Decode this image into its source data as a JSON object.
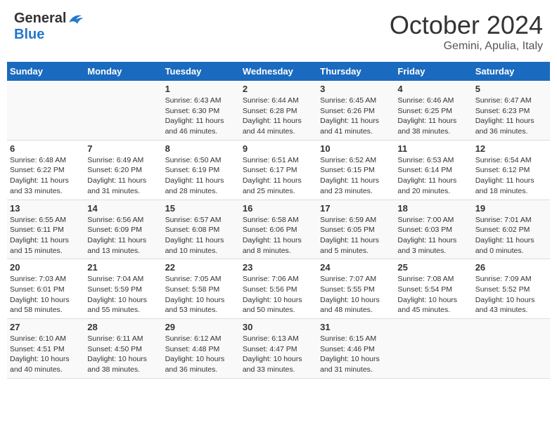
{
  "header": {
    "logo_general": "General",
    "logo_blue": "Blue",
    "month": "October 2024",
    "location": "Gemini, Apulia, Italy"
  },
  "columns": [
    "Sunday",
    "Monday",
    "Tuesday",
    "Wednesday",
    "Thursday",
    "Friday",
    "Saturday"
  ],
  "weeks": [
    [
      {
        "day": "",
        "content": ""
      },
      {
        "day": "",
        "content": ""
      },
      {
        "day": "1",
        "content": "Sunrise: 6:43 AM\nSunset: 6:30 PM\nDaylight: 11 hours\nand 46 minutes."
      },
      {
        "day": "2",
        "content": "Sunrise: 6:44 AM\nSunset: 6:28 PM\nDaylight: 11 hours\nand 44 minutes."
      },
      {
        "day": "3",
        "content": "Sunrise: 6:45 AM\nSunset: 6:26 PM\nDaylight: 11 hours\nand 41 minutes."
      },
      {
        "day": "4",
        "content": "Sunrise: 6:46 AM\nSunset: 6:25 PM\nDaylight: 11 hours\nand 38 minutes."
      },
      {
        "day": "5",
        "content": "Sunrise: 6:47 AM\nSunset: 6:23 PM\nDaylight: 11 hours\nand 36 minutes."
      }
    ],
    [
      {
        "day": "6",
        "content": "Sunrise: 6:48 AM\nSunset: 6:22 PM\nDaylight: 11 hours\nand 33 minutes."
      },
      {
        "day": "7",
        "content": "Sunrise: 6:49 AM\nSunset: 6:20 PM\nDaylight: 11 hours\nand 31 minutes."
      },
      {
        "day": "8",
        "content": "Sunrise: 6:50 AM\nSunset: 6:19 PM\nDaylight: 11 hours\nand 28 minutes."
      },
      {
        "day": "9",
        "content": "Sunrise: 6:51 AM\nSunset: 6:17 PM\nDaylight: 11 hours\nand 25 minutes."
      },
      {
        "day": "10",
        "content": "Sunrise: 6:52 AM\nSunset: 6:15 PM\nDaylight: 11 hours\nand 23 minutes."
      },
      {
        "day": "11",
        "content": "Sunrise: 6:53 AM\nSunset: 6:14 PM\nDaylight: 11 hours\nand 20 minutes."
      },
      {
        "day": "12",
        "content": "Sunrise: 6:54 AM\nSunset: 6:12 PM\nDaylight: 11 hours\nand 18 minutes."
      }
    ],
    [
      {
        "day": "13",
        "content": "Sunrise: 6:55 AM\nSunset: 6:11 PM\nDaylight: 11 hours\nand 15 minutes."
      },
      {
        "day": "14",
        "content": "Sunrise: 6:56 AM\nSunset: 6:09 PM\nDaylight: 11 hours\nand 13 minutes."
      },
      {
        "day": "15",
        "content": "Sunrise: 6:57 AM\nSunset: 6:08 PM\nDaylight: 11 hours\nand 10 minutes."
      },
      {
        "day": "16",
        "content": "Sunrise: 6:58 AM\nSunset: 6:06 PM\nDaylight: 11 hours\nand 8 minutes."
      },
      {
        "day": "17",
        "content": "Sunrise: 6:59 AM\nSunset: 6:05 PM\nDaylight: 11 hours\nand 5 minutes."
      },
      {
        "day": "18",
        "content": "Sunrise: 7:00 AM\nSunset: 6:03 PM\nDaylight: 11 hours\nand 3 minutes."
      },
      {
        "day": "19",
        "content": "Sunrise: 7:01 AM\nSunset: 6:02 PM\nDaylight: 11 hours\nand 0 minutes."
      }
    ],
    [
      {
        "day": "20",
        "content": "Sunrise: 7:03 AM\nSunset: 6:01 PM\nDaylight: 10 hours\nand 58 minutes."
      },
      {
        "day": "21",
        "content": "Sunrise: 7:04 AM\nSunset: 5:59 PM\nDaylight: 10 hours\nand 55 minutes."
      },
      {
        "day": "22",
        "content": "Sunrise: 7:05 AM\nSunset: 5:58 PM\nDaylight: 10 hours\nand 53 minutes."
      },
      {
        "day": "23",
        "content": "Sunrise: 7:06 AM\nSunset: 5:56 PM\nDaylight: 10 hours\nand 50 minutes."
      },
      {
        "day": "24",
        "content": "Sunrise: 7:07 AM\nSunset: 5:55 PM\nDaylight: 10 hours\nand 48 minutes."
      },
      {
        "day": "25",
        "content": "Sunrise: 7:08 AM\nSunset: 5:54 PM\nDaylight: 10 hours\nand 45 minutes."
      },
      {
        "day": "26",
        "content": "Sunrise: 7:09 AM\nSunset: 5:52 PM\nDaylight: 10 hours\nand 43 minutes."
      }
    ],
    [
      {
        "day": "27",
        "content": "Sunrise: 6:10 AM\nSunset: 4:51 PM\nDaylight: 10 hours\nand 40 minutes."
      },
      {
        "day": "28",
        "content": "Sunrise: 6:11 AM\nSunset: 4:50 PM\nDaylight: 10 hours\nand 38 minutes."
      },
      {
        "day": "29",
        "content": "Sunrise: 6:12 AM\nSunset: 4:48 PM\nDaylight: 10 hours\nand 36 minutes."
      },
      {
        "day": "30",
        "content": "Sunrise: 6:13 AM\nSunset: 4:47 PM\nDaylight: 10 hours\nand 33 minutes."
      },
      {
        "day": "31",
        "content": "Sunrise: 6:15 AM\nSunset: 4:46 PM\nDaylight: 10 hours\nand 31 minutes."
      },
      {
        "day": "",
        "content": ""
      },
      {
        "day": "",
        "content": ""
      }
    ]
  ]
}
